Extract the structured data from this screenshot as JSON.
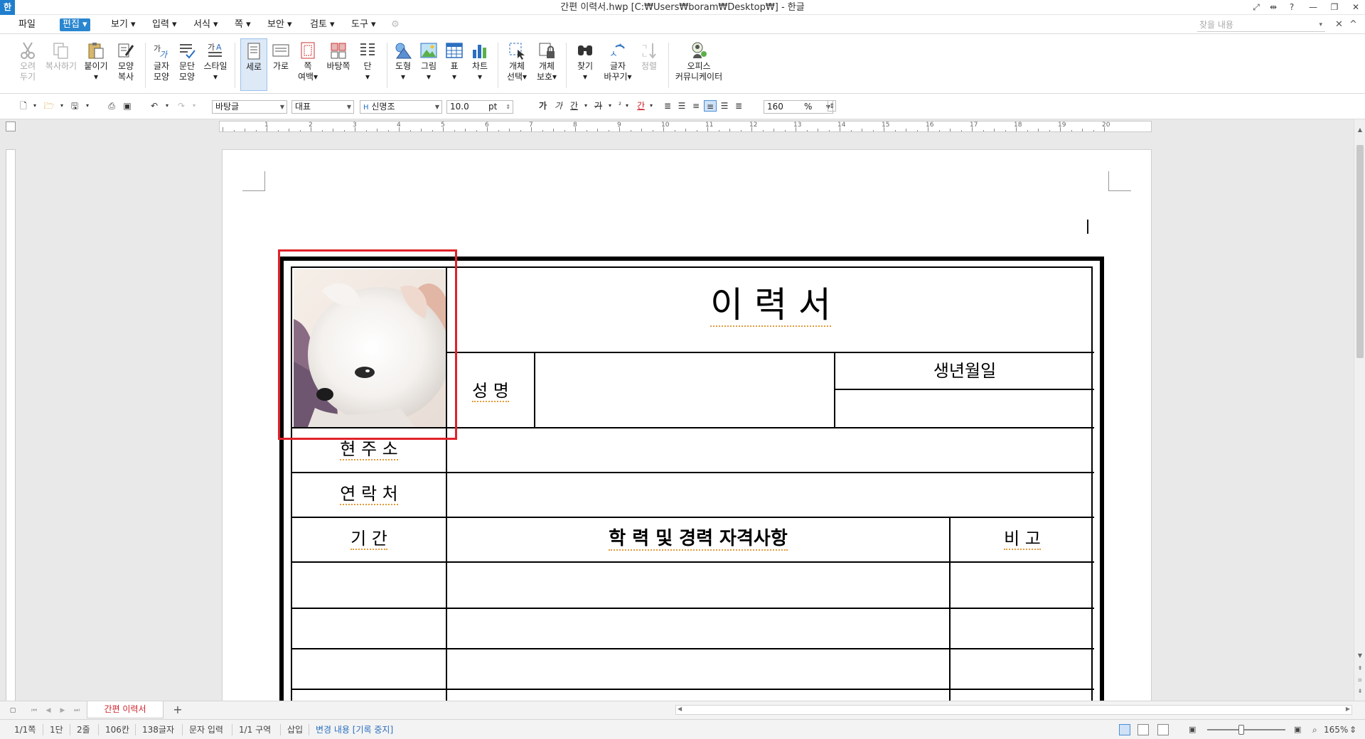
{
  "window": {
    "title": "간편 이력서.hwp [C:₩Users₩boram₩Desktop₩] - 한글",
    "logo": "한",
    "controls": [
      "⤢",
      "⇹",
      "?",
      "—",
      "❐",
      "✕"
    ]
  },
  "menu": {
    "items": [
      {
        "label": "파일"
      },
      {
        "label": "편집 ▾",
        "active": true
      },
      {
        "label": "보기 ▾"
      },
      {
        "label": "입력 ▾"
      },
      {
        "label": "서식 ▾"
      },
      {
        "label": "쪽 ▾"
      },
      {
        "label": "보안 ▾"
      },
      {
        "label": "검토 ▾"
      },
      {
        "label": "도구 ▾"
      }
    ],
    "search_placeholder": "찾을 내용",
    "right_controls": [
      "▾",
      "✕",
      "^"
    ]
  },
  "ribbon": {
    "buttons": [
      {
        "label": "오려\n두기",
        "icon": "scissors-icon",
        "disabled": true
      },
      {
        "label": "복사하기",
        "icon": "copy-icon",
        "disabled": true
      },
      {
        "label": "붙이기\n▾",
        "icon": "paste-icon"
      },
      {
        "label": "모양\n복사",
        "icon": "format-painter-icon"
      },
      {
        "label": "글자\n모양",
        "icon": "char-shape-icon"
      },
      {
        "label": "문단\n모양",
        "icon": "para-shape-icon"
      },
      {
        "label": "스타일\n▾",
        "icon": "style-icon"
      },
      {
        "label": "세로",
        "icon": "portrait-icon",
        "selected": true
      },
      {
        "label": "가로",
        "icon": "landscape-icon"
      },
      {
        "label": "쪽\n여백▾",
        "icon": "page-margin-icon"
      },
      {
        "label": "바탕쪽",
        "icon": "master-page-icon"
      },
      {
        "label": "단\n▾",
        "icon": "columns-icon"
      },
      {
        "label": "도형\n▾",
        "icon": "shapes-icon"
      },
      {
        "label": "그림\n▾",
        "icon": "picture-icon"
      },
      {
        "label": "표\n▾",
        "icon": "table-icon"
      },
      {
        "label": "차트\n▾",
        "icon": "chart-icon"
      },
      {
        "label": "개체\n선택▾",
        "icon": "object-select-icon"
      },
      {
        "label": "개체\n보호▾",
        "icon": "object-protect-icon"
      },
      {
        "label": "찾기\n▾",
        "icon": "find-icon"
      },
      {
        "label": "글자\n바꾸기▾",
        "icon": "replace-icon"
      },
      {
        "label": "정렬",
        "icon": "sort-icon",
        "disabled": true
      },
      {
        "label": "오피스\n커뮤니케이터",
        "icon": "office-communicator-icon"
      }
    ]
  },
  "format": {
    "style": "바탕글",
    "lang": "대표",
    "font": "신명조",
    "font_prefix": "H",
    "size": "10.0",
    "unit": "pt",
    "bold": "가",
    "italic": "가",
    "underline": "간",
    "strike": "가",
    "color_char": "가",
    "highlight_char": "간",
    "zoom": "160",
    "zoom_unit": "%"
  },
  "ruler": {
    "numbers": [
      "1",
      "2",
      "3",
      "4",
      "5",
      "6",
      "7",
      "8",
      "9",
      "10",
      "11",
      "12",
      "13",
      "14",
      "15",
      "16",
      "17",
      "18",
      "19",
      "20"
    ]
  },
  "document": {
    "title": "이   력   서",
    "name_label": "성   명",
    "birth_label": "생년월일",
    "address_label": "현 주 소",
    "contact_label": "연 락 처",
    "period_label": "기     간",
    "history_label": "학 력 및 경력 자격사항",
    "note_label": "비     고"
  },
  "tabs": {
    "doc_tab": "간편 이력서",
    "add": "+"
  },
  "status": {
    "page": "1/1쪽",
    "column": "1단",
    "line": "2줄",
    "col_pos": "106칸",
    "chars": "138글자",
    "mode": "문자 입력",
    "section": "1/1 구역",
    "insert": "삽입",
    "track": "변경 내용 [기록 중지]",
    "zoom": "165%"
  },
  "colors": {
    "accent": "#2a86cf",
    "selection": "#e0222a",
    "tab_text": "#d0202a"
  }
}
